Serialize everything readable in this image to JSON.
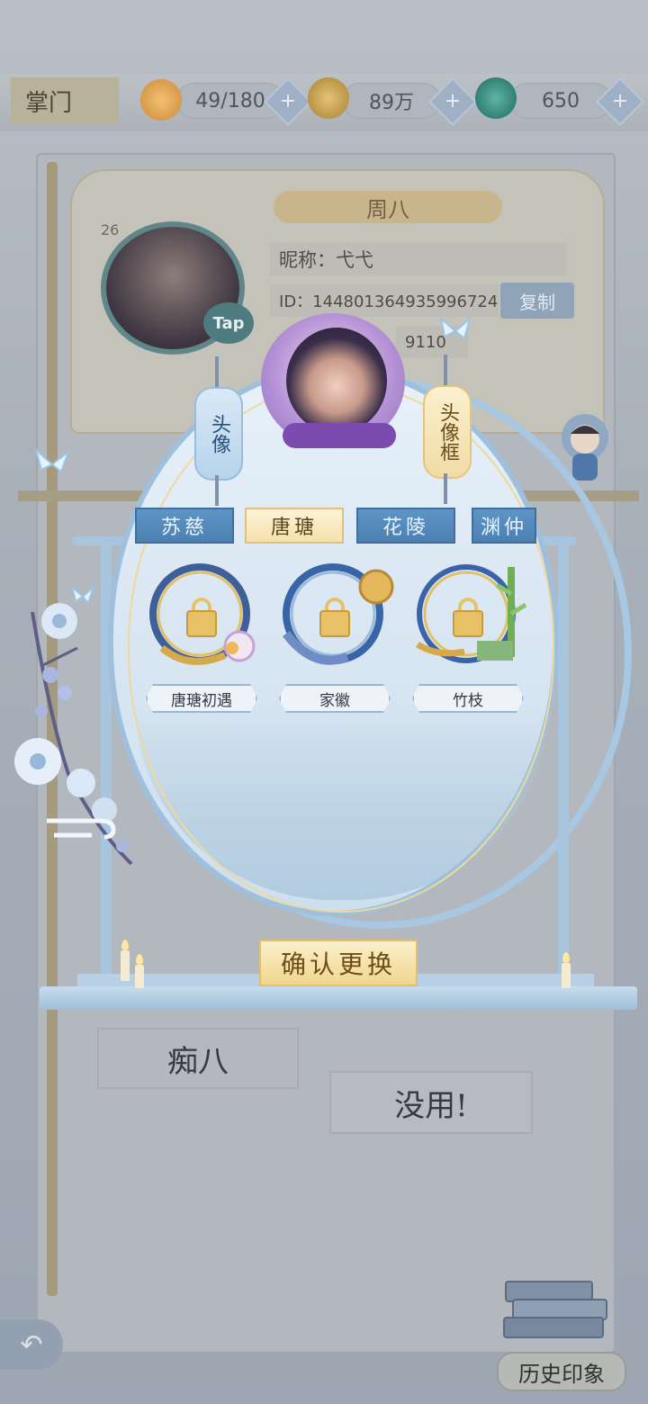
{
  "header": {
    "section_title": "掌门",
    "stamina": "49/180",
    "coins": "89万",
    "jade": "650",
    "plus_label": "+"
  },
  "profile": {
    "level": "26",
    "tap_badge": "Tap",
    "name_banner": "周八",
    "nickname": "昵称：弋弋",
    "id": "ID：144801364935996724",
    "copy_label": "复制",
    "partial_number": "9110"
  },
  "modal": {
    "tab_avatar": "头像",
    "tab_frame": "头像框",
    "character_tabs": [
      "苏慈",
      "唐瑭",
      "花陵",
      "渊仲"
    ],
    "active_character_tab": "唐瑭",
    "frames": [
      {
        "name": "唐瑭初遇",
        "locked": true
      },
      {
        "name": "家徽",
        "locked": true
      },
      {
        "name": "竹枝",
        "locked": true
      }
    ],
    "confirm_label": "确认更换"
  },
  "bottom": {
    "name_tag": "痴八",
    "quote": "没用!",
    "history_label": "历史印象",
    "back_icon": "back-arrow-icon"
  },
  "colors": {
    "accent_blue": "#4c80b2",
    "accent_gold": "#f0d68e",
    "frame_blue": "#a7c5df"
  }
}
